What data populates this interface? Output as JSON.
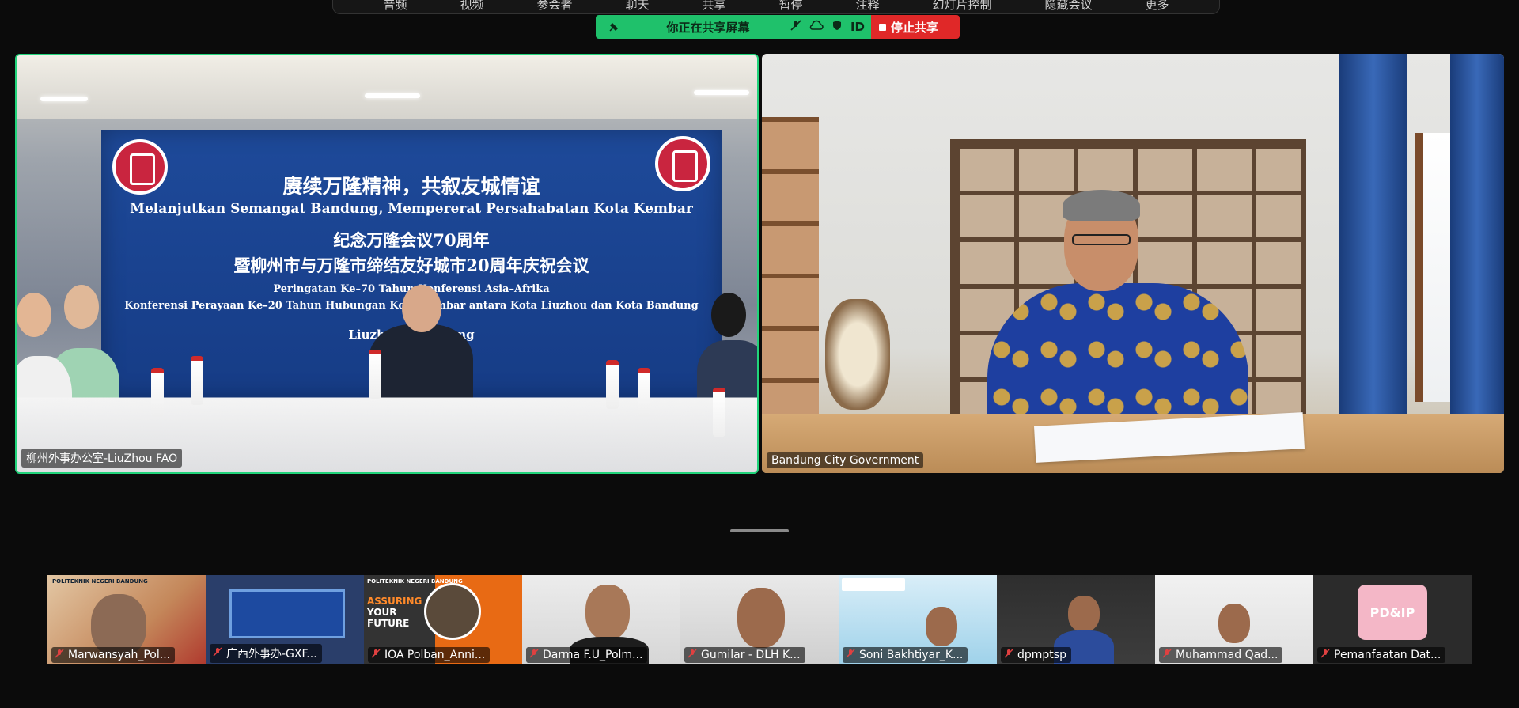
{
  "toolbar": {
    "items": [
      "音频",
      "视频",
      "参会者",
      "聊天",
      "共享",
      "暂停",
      "注释",
      "幻灯片控制",
      "隐藏会议",
      "更多"
    ]
  },
  "share_bar": {
    "status_text": "你正在共享屏幕",
    "id_label": "ID",
    "stop_label": "停止共享",
    "colors": {
      "green": "#1fc16b",
      "red": "#e02828"
    }
  },
  "main_videos": {
    "left": {
      "participant": "柳州外事办公室-LiuZhou FAO",
      "banner": {
        "line1": "赓续万隆精神，共叙友城情谊",
        "line2": "Melanjutkan Semangat Bandung, Mempererat Persahabatan Kota Kembar",
        "line3": "纪念万隆会议70周年",
        "line4": "暨柳州市与万隆市缔结友好城市20周年庆祝会议",
        "line5": "Peringatan Ke–70 Tahun Konferensi Asia–Afrika",
        "line6": "Konferensi Perayaan Ke–20 Tahun Hubungan Kota Kembar antara Kota Liuzhou dan Kota Bandung",
        "line7": "Liuzhou · Bandung"
      }
    },
    "right": {
      "participant": "Bandung City Government"
    }
  },
  "thumbnails": [
    {
      "name": "Marwansyah_Pol...",
      "muted": true
    },
    {
      "name": "广西外事办-GXF...",
      "muted": true
    },
    {
      "name": "IOA Polban_Anni...",
      "muted": true
    },
    {
      "name": "Darma F.U_Polm...",
      "muted": true
    },
    {
      "name": "Gumilar - DLH K...",
      "muted": true
    },
    {
      "name": "Soni Bakhtiyar_K...",
      "muted": true
    },
    {
      "name": "dpmptsp",
      "muted": true
    },
    {
      "name": "Muhammad Qad...",
      "muted": true
    },
    {
      "name": "Pemanfaatan Dat...",
      "muted": true
    }
  ],
  "thumbnail_text": {
    "polban": "POLITEKNIK NEGERI BANDUNG",
    "assuring": "ASSURING",
    "your": "YOUR",
    "future": "FUTURE",
    "pdip": "PD&IP"
  }
}
